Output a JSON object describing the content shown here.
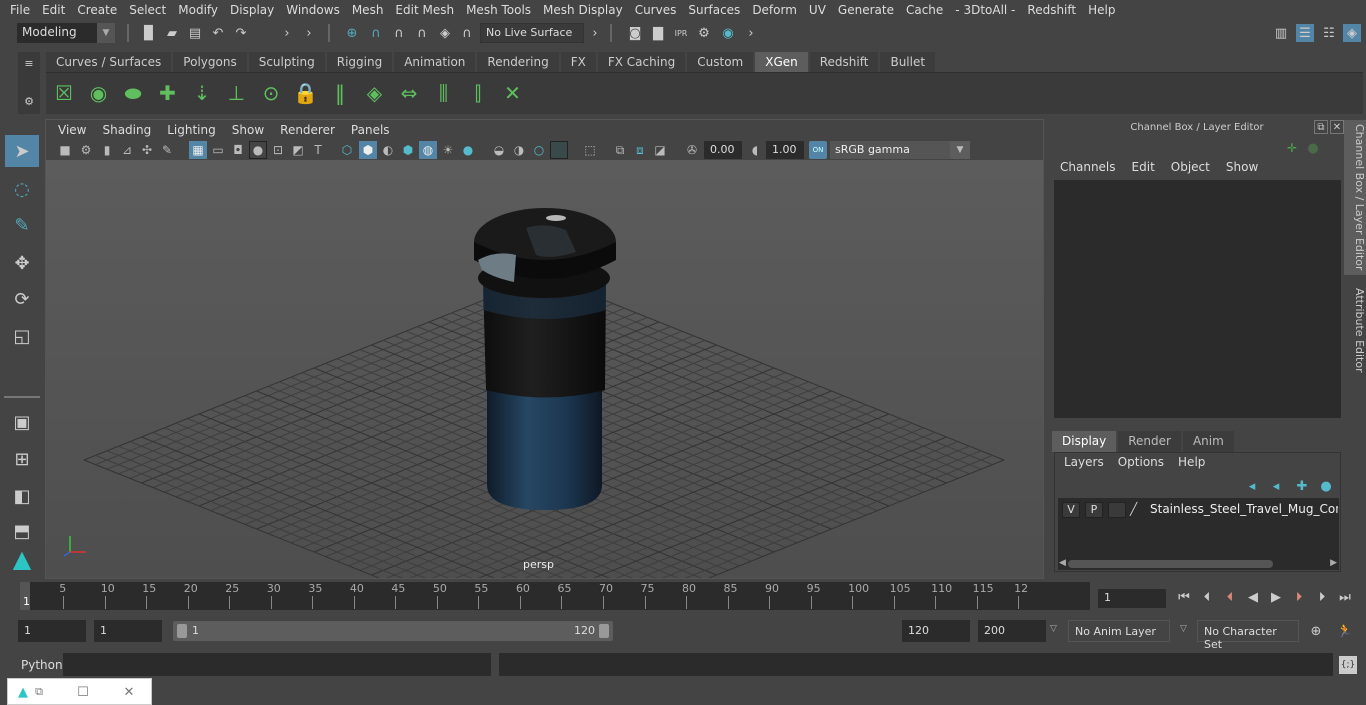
{
  "menubar": [
    "File",
    "Edit",
    "Create",
    "Select",
    "Modify",
    "Display",
    "Windows",
    "Mesh",
    "Edit Mesh",
    "Mesh Tools",
    "Mesh Display",
    "Curves",
    "Surfaces",
    "Deform",
    "UV",
    "Generate",
    "Cache",
    "- 3DtoAll -",
    "Redshift",
    "Help"
  ],
  "statusline": {
    "mode": "Modeling",
    "live_surface": "No Live Surface"
  },
  "shelf": {
    "tabs": [
      "Curves / Surfaces",
      "Polygons",
      "Sculpting",
      "Rigging",
      "Animation",
      "Rendering",
      "FX",
      "FX Caching",
      "Custom",
      "XGen",
      "Redshift",
      "Bullet"
    ],
    "active_tab": "XGen",
    "icons": [
      "xgen-editor-icon",
      "preview-icon",
      "clear-preview-icon",
      "add-description-icon",
      "place-guides-icon",
      "add-guide-icon",
      "show-guides-icon",
      "lock-guides-icon",
      "split-guides-icon",
      "sculpt-layer-icon",
      "guide-normalize-icon",
      "create-guides-icon",
      "guide-rebuild-icon",
      "delete-guides-icon"
    ]
  },
  "toolbox": [
    "select-tool",
    "lasso-tool",
    "paint-select-tool",
    "move-tool",
    "rotate-tool",
    "scale-tool"
  ],
  "viewport": {
    "menu": [
      "View",
      "Shading",
      "Lighting",
      "Show",
      "Renderer",
      "Panels"
    ],
    "exposure": "0.00",
    "gamma": "1.00",
    "color_management": "ON",
    "view_transform": "sRGB gamma",
    "camera_label": "persp"
  },
  "channel_box": {
    "title": "Channel Box / Layer Editor",
    "menu": [
      "Channels",
      "Edit",
      "Object",
      "Show"
    ]
  },
  "layer_editor": {
    "tabs": [
      "Display",
      "Render",
      "Anim"
    ],
    "active_tab": "Display",
    "menu": [
      "Layers",
      "Options",
      "Help"
    ],
    "layers": [
      {
        "v": "V",
        "p": "P",
        "name": "Stainless_Steel_Travel_Mug_Contigo_"
      }
    ]
  },
  "side_tabs": [
    "Channel Box / Layer Editor",
    "Attribute Editor"
  ],
  "timeline": {
    "ticks": [
      "5",
      "10",
      "15",
      "20",
      "25",
      "30",
      "35",
      "40",
      "45",
      "50",
      "55",
      "60",
      "65",
      "70",
      "75",
      "80",
      "85",
      "90",
      "95",
      "100",
      "105",
      "110",
      "115",
      "12"
    ],
    "current_marker": "1",
    "current_frame": "1"
  },
  "range": {
    "start": "1",
    "playback_start": "1",
    "slider_min": "1",
    "slider_max": "120",
    "playback_end": "120",
    "end": "200",
    "anim_layer": "No Anim Layer",
    "character_set": "No Character Set"
  },
  "command_line": {
    "language": "Python"
  }
}
